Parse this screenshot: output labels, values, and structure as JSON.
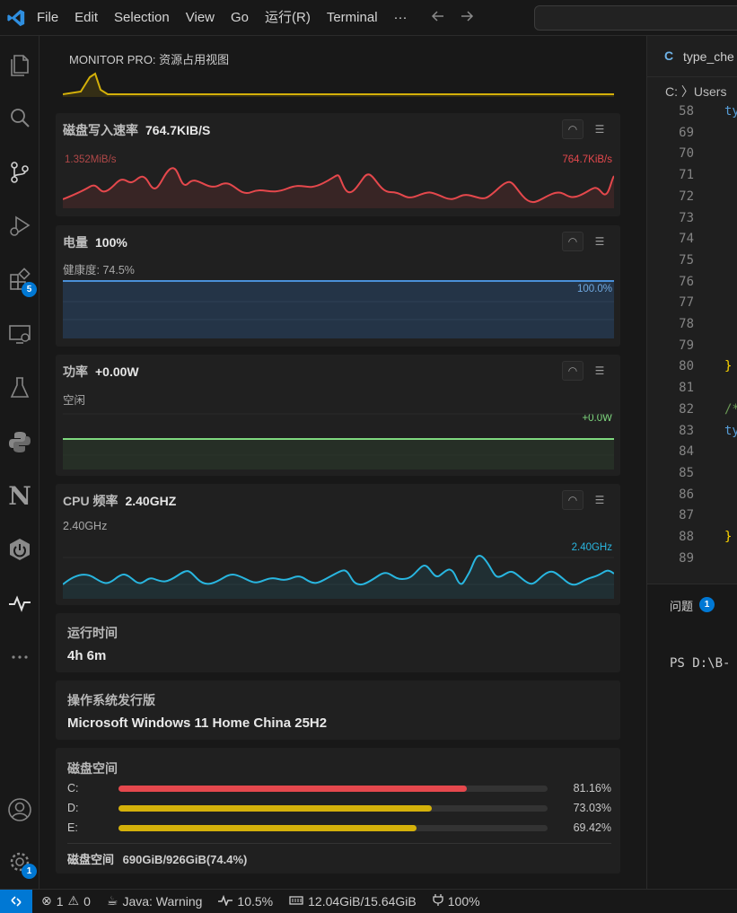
{
  "titlebar": {
    "menu": [
      "File",
      "Edit",
      "Selection",
      "View",
      "Go",
      "运行(R)",
      "Terminal",
      "···"
    ]
  },
  "activity": {
    "extensions_badge": "5",
    "settings_badge": "1"
  },
  "sidebar": {
    "header": "MONITOR PRO: 资源占用视图",
    "disk_write": {
      "label": "磁盘写入速率",
      "value": "764.7KIB/S",
      "max_label": "1.352MiB/s",
      "current_label": "764.7KiB/s",
      "color": "#e5484d"
    },
    "battery": {
      "label": "电量",
      "value": "100%",
      "sub": "健康度: 74.5%",
      "current_label": "100.0%",
      "color": "#4a90d9"
    },
    "power": {
      "label": "功率",
      "value": "+0.00W",
      "sub": "空闲",
      "current_label": "+0.0W",
      "color": "#7fd97f"
    },
    "cpu_freq": {
      "label": "CPU 频率",
      "value": "2.40GHZ",
      "sub": "2.40GHz",
      "current_label": "2.40GHz",
      "color": "#29b6e0"
    },
    "uptime": {
      "label": "运行时间",
      "value": "4h 6m"
    },
    "os": {
      "label": "操作系统发行版",
      "value": "Microsoft Windows 11 Home China 25H2"
    },
    "disk_space": {
      "label": "磁盘空间",
      "drives": [
        {
          "name": "C:",
          "percent": "81.16%",
          "fraction": 0.8116,
          "color": "#e5484d"
        },
        {
          "name": "D:",
          "percent": "73.03%",
          "fraction": 0.7303,
          "color": "#d4b10a"
        },
        {
          "name": "E:",
          "percent": "69.42%",
          "fraction": 0.6942,
          "color": "#d4b10a"
        }
      ],
      "summary_label": "磁盘空间",
      "summary_value": "690GiB/926GiB(74.4%)"
    }
  },
  "editor": {
    "tab_icon": "C",
    "tab_name": "type_che",
    "breadcrumb": "C: 〉Users",
    "lines": [
      {
        "n": "58",
        "code": "ty",
        "color": "#569cd6"
      },
      {
        "n": "69",
        "code": "",
        "color": "#cccccc"
      },
      {
        "n": "70",
        "code": "",
        "color": "#cccccc"
      },
      {
        "n": "71",
        "code": "",
        "color": "#cccccc"
      },
      {
        "n": "72",
        "code": "",
        "color": "#cccccc"
      },
      {
        "n": "73",
        "code": "",
        "color": "#cccccc"
      },
      {
        "n": "74",
        "code": "",
        "color": "#cccccc"
      },
      {
        "n": "75",
        "code": "",
        "color": "#cccccc"
      },
      {
        "n": "76",
        "code": "",
        "color": "#cccccc"
      },
      {
        "n": "77",
        "code": "",
        "color": "#cccccc"
      },
      {
        "n": "78",
        "code": "",
        "color": "#cccccc"
      },
      {
        "n": "79",
        "code": "",
        "color": "#cccccc"
      },
      {
        "n": "80",
        "code": "}",
        "color": "#ffd700"
      },
      {
        "n": "81",
        "code": "",
        "color": "#cccccc"
      },
      {
        "n": "82",
        "code": "/*",
        "color": "#6a9955"
      },
      {
        "n": "83",
        "code": "ty",
        "color": "#569cd6"
      },
      {
        "n": "84",
        "code": "",
        "color": "#cccccc"
      },
      {
        "n": "85",
        "code": "",
        "color": "#cccccc"
      },
      {
        "n": "86",
        "code": "",
        "color": "#cccccc"
      },
      {
        "n": "87",
        "code": "",
        "color": "#cccccc"
      },
      {
        "n": "88",
        "code": "}",
        "color": "#ffd700"
      },
      {
        "n": "89",
        "code": "",
        "color": "#cccccc"
      }
    ],
    "panel_title": "问题",
    "panel_badge": "1",
    "terminal": "PS D:\\B-"
  },
  "status": {
    "errors": "1",
    "warnings": "0",
    "java": "Java: Warning",
    "cpu": "10.5%",
    "memory": "12.04GiB/15.64GiB",
    "battery": "100%"
  },
  "colors": {
    "accent": "#0078d4"
  }
}
